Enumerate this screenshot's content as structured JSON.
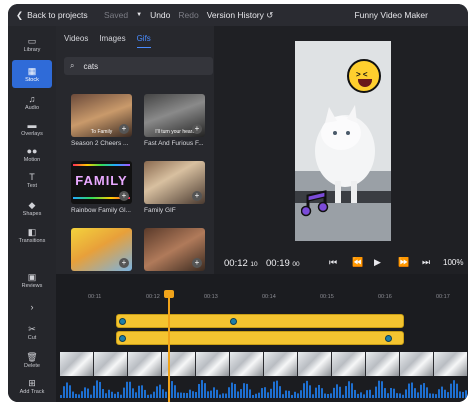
{
  "header": {
    "back_label": "Back to projects",
    "saved_label": "Saved",
    "undo_label": "Undo",
    "redo_label": "Redo",
    "version_history_label": "Version History",
    "project_title": "Funny Video Maker"
  },
  "sidebar": {
    "items": [
      {
        "label": "Library",
        "icon": "folder-icon"
      },
      {
        "label": "Stock",
        "icon": "stock-icon",
        "active": true
      },
      {
        "label": "Audio",
        "icon": "music-note-icon"
      },
      {
        "label": "Overlays",
        "icon": "overlays-icon"
      },
      {
        "label": "Motion",
        "icon": "motion-icon"
      },
      {
        "label": "Text",
        "icon": "text-icon"
      },
      {
        "label": "Shapes",
        "icon": "shapes-icon"
      },
      {
        "label": "Transitions",
        "icon": "transitions-icon"
      },
      {
        "label": "Reviews",
        "icon": "chat-icon"
      },
      {
        "label": "Cut",
        "icon": "scissors-icon"
      },
      {
        "label": "Delete",
        "icon": "trash-icon"
      },
      {
        "label": "Add Track",
        "icon": "add-track-icon"
      }
    ]
  },
  "media_panel": {
    "tabs": [
      "Videos",
      "Images",
      "Gifs"
    ],
    "active_tab": "Gifs",
    "search_value": "cats",
    "results": [
      {
        "label": "Season 2 Cheers ...",
        "caption": "To Family"
      },
      {
        "label": "Fast And Furious F...",
        "caption": "I'll turn your heart"
      },
      {
        "label": "Rainbow Family Gl...",
        "caption": "FAMILY"
      },
      {
        "label": "Family GIF",
        "caption": ""
      },
      {
        "label": "",
        "caption": ""
      },
      {
        "label": "",
        "caption": ""
      }
    ]
  },
  "player": {
    "current_time": "00:12",
    "current_frames": "10",
    "total_time": "00:19",
    "total_frames": "00",
    "zoom": "100%"
  },
  "timeline": {
    "ticks": [
      "00:11",
      "00:12",
      "00:13",
      "00:14",
      "00:15",
      "00:16",
      "00:17"
    ]
  },
  "colors": {
    "accent": "#2f6bd8",
    "track": "#f4c430",
    "playhead": "#f0a31a",
    "waveform": "#1e6fd0"
  }
}
